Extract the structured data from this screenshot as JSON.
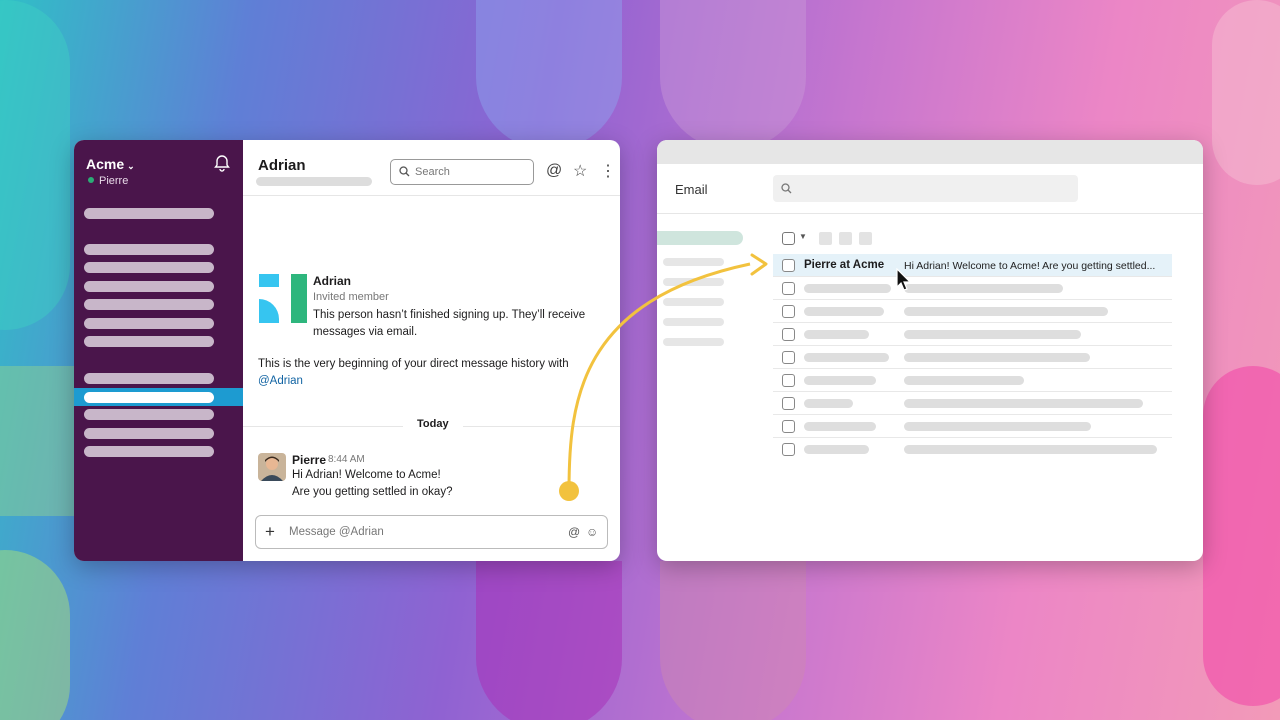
{
  "slack": {
    "workspace": "Acme",
    "current_user": "Pierre",
    "channel_title": "Adrian",
    "search_placeholder": "Search",
    "member": {
      "name": "Adrian",
      "role": "Invited member",
      "description": "This person hasn’t finished signing up. They’ll receive messages via email."
    },
    "intro_text": "This is the very beginning of your direct message history with",
    "intro_mention": "@Adrian",
    "divider_label": "Today",
    "message": {
      "sender": "Pierre",
      "time": "8:44 AM",
      "line1": "Hi Adrian! Welcome to Acme!",
      "line2": "Are you getting settled in okay?"
    },
    "composer_placeholder": "Message @Adrian",
    "colors": {
      "sidebar": "#4a154b",
      "active": "#1d9bd1",
      "online": "#2bac76"
    }
  },
  "email": {
    "title": "Email",
    "selected_row": {
      "sender": "Pierre at Acme",
      "snippet": "Hi Adrian! Welcome to Acme! Are you getting settled..."
    }
  },
  "arrow_color": "#f2c23e"
}
